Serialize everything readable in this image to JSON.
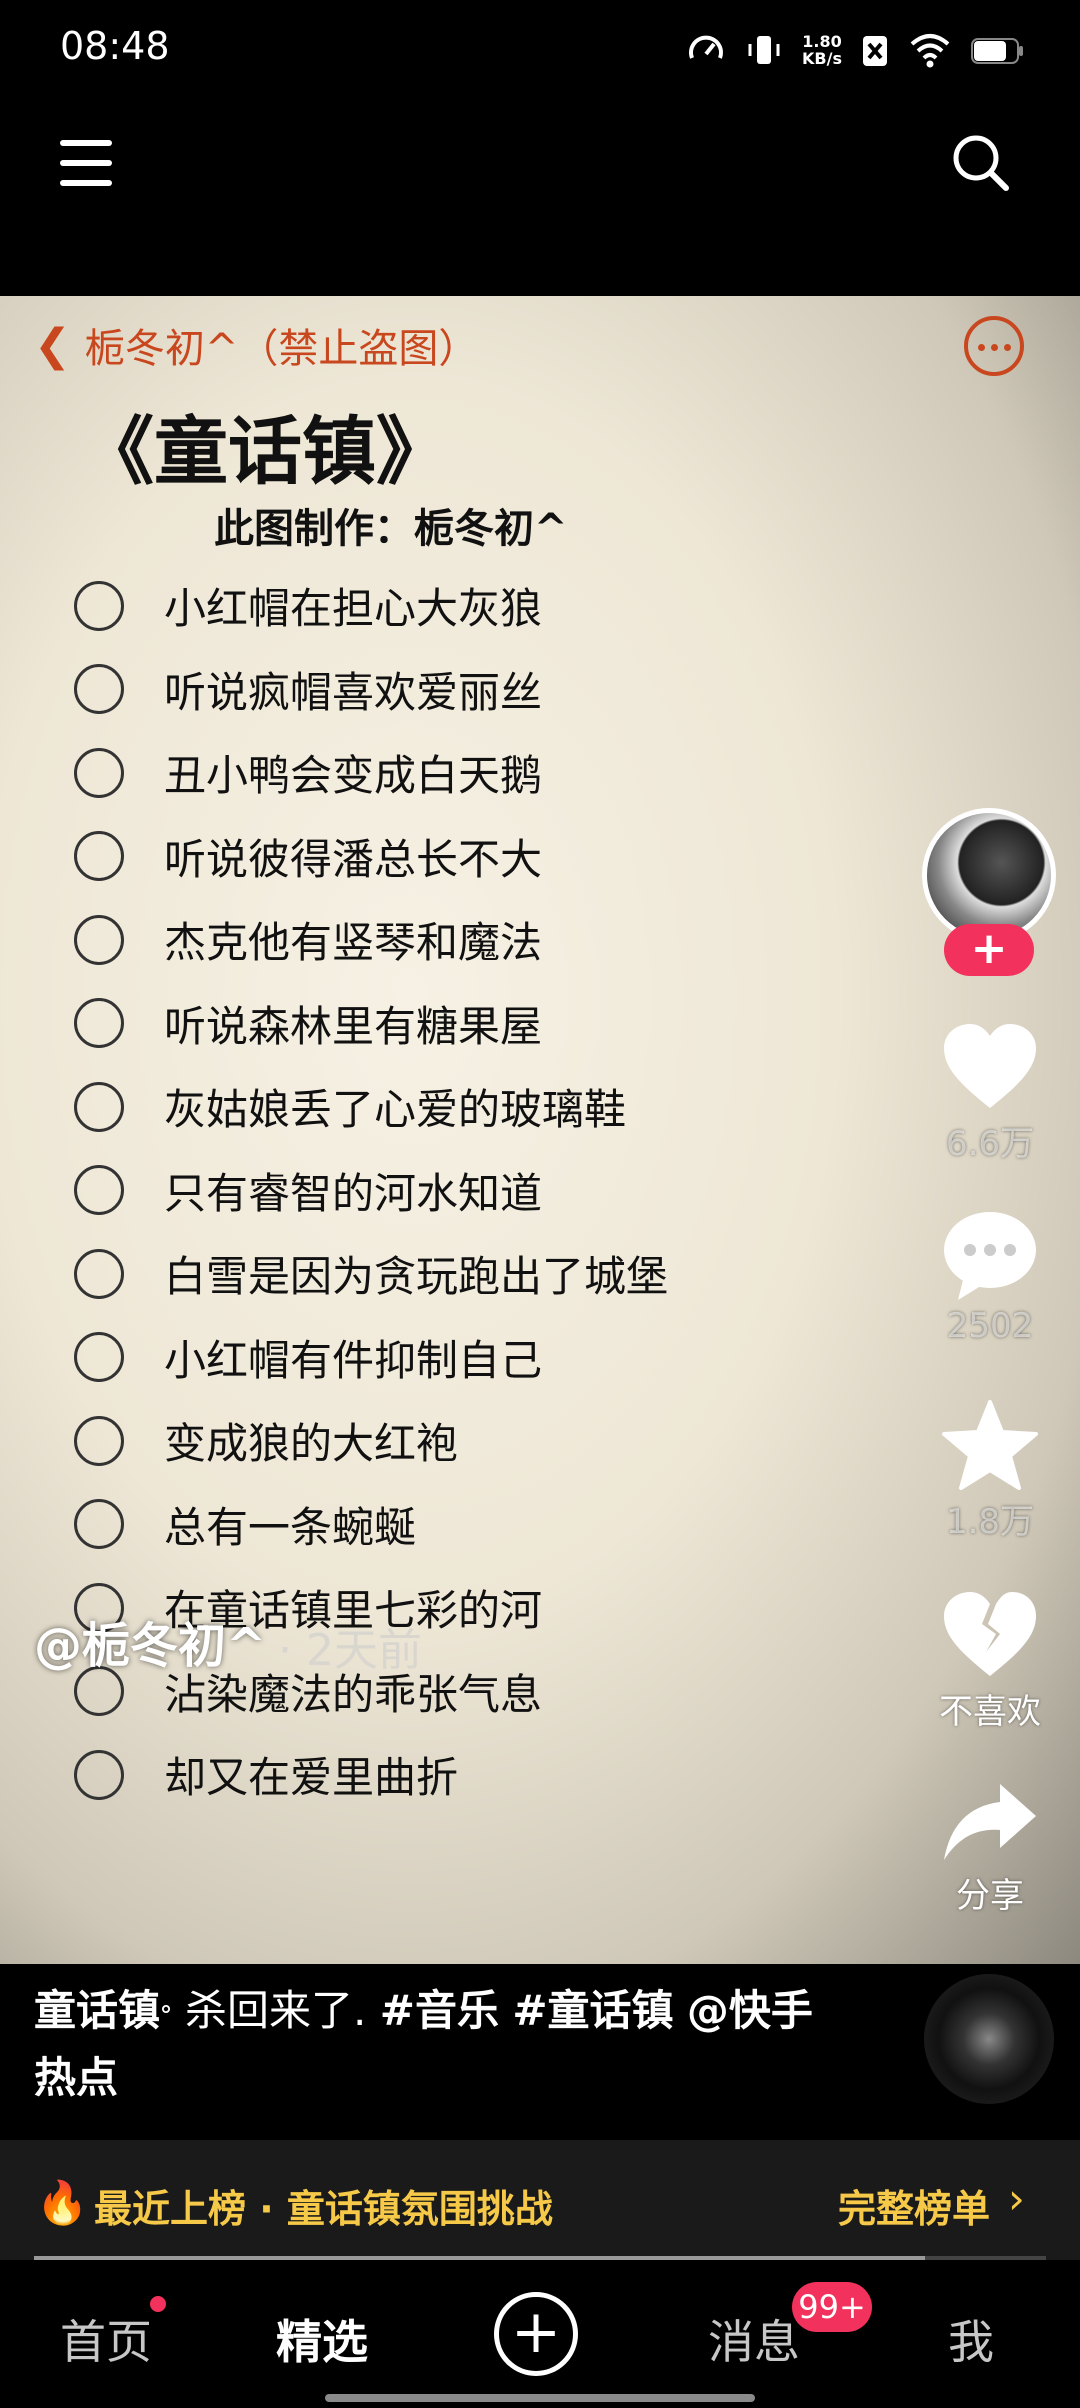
{
  "status_bar": {
    "time": "08:48",
    "net_speed_value": "1.80",
    "net_speed_unit": "KB/s"
  },
  "post": {
    "author_header": "栀冬初^（禁止盗图）",
    "song_title": "《童话镇》",
    "credit": "此图制作：栀冬初^",
    "lyrics": [
      "小红帽在担心大灰狼",
      "听说疯帽喜欢爱丽丝",
      "丑小鸭会变成白天鹅",
      "听说彼得潘总长不大",
      "杰克他有竖琴和魔法",
      "听说森林里有糖果屋",
      "灰姑娘丢了心爱的玻璃鞋",
      "只有睿智的河水知道",
      "白雪是因为贪玩跑出了城堡",
      "小红帽有件抑制自己",
      "变成狼的大红袍",
      "总有一条蜿蜒",
      "在童话镇里七彩的河",
      "沾染魔法的乖张气息",
      "却又在爱里曲折"
    ],
    "author_name": "@栀冬初^",
    "time_ago": "· 2天前"
  },
  "actions": {
    "likes": "6.6万",
    "comments": "2502",
    "favorites": "1.8万",
    "dislike": "不喜欢",
    "share": "分享"
  },
  "caption": {
    "song_tag": "童话镇",
    "search_glyph": "ᐤ",
    "text": " 杀回来了. ",
    "tag1": "#音乐",
    "tag2": "#童话镇",
    "mention": "@快手热点"
  },
  "rank_bar": {
    "text": "最近上榜 · 童话镇氛围挑战",
    "full_list": "完整榜单"
  },
  "playback_progress": 0.88,
  "bottom_nav": {
    "home": "首页",
    "featured": "精选",
    "create": "+",
    "messages": "消息",
    "messages_badge": "99+",
    "me": "我"
  },
  "colors": {
    "accent_orange": "#c9471e",
    "follow_pink": "#f2315c",
    "rank_gold": "#f7c948"
  }
}
